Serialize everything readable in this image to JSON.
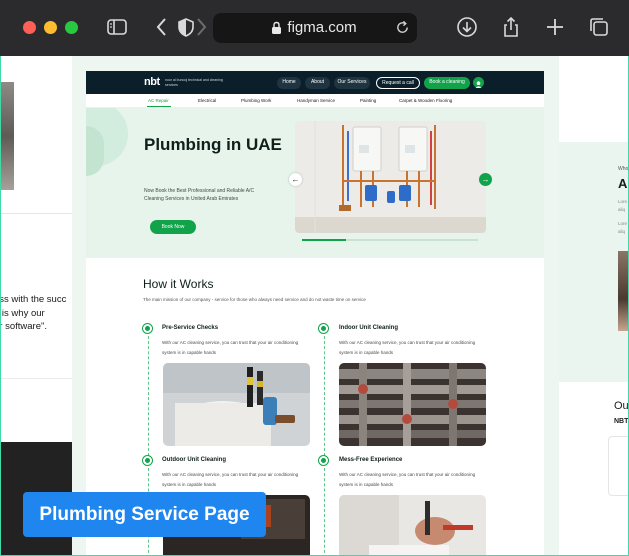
{
  "browser": {
    "url": "figma.com",
    "colors": {
      "chrome": "#2b2b2d",
      "urlbar": "#161617"
    }
  },
  "left_panel": {
    "quote_lines": [
      "ess with the succ",
      "h is why our",
      "ur software\"."
    ]
  },
  "right_panel": {
    "small_label": "Who",
    "big_text": "Al",
    "text_lines": [
      "Lore",
      "aliq",
      "Lore",
      "aliq"
    ],
    "heading": "Ou",
    "brand": "NBT"
  },
  "site": {
    "logo_mark": "nbt",
    "logo_text": "noor al bunooj technical and cleaning services",
    "nav": [
      {
        "label": "Home"
      },
      {
        "label": "About"
      },
      {
        "label": "Our Services"
      },
      {
        "label": "Request a call"
      },
      {
        "label": "Book a cleaning"
      }
    ],
    "subnav": [
      {
        "label": "AC Repair",
        "active": true
      },
      {
        "label": "Electrical"
      },
      {
        "label": "Plumbing Work"
      },
      {
        "label": "Handyman Service"
      },
      {
        "label": "Painting"
      },
      {
        "label": "Carpet & Wooden Flooring"
      }
    ],
    "hero": {
      "title": "Plumbing in UAE",
      "subtitle": "Now Book the Best Professional and Reliable A/C Cleaning Services in United Arab Emirates",
      "button": "Book Now",
      "slide_progress": 0.25,
      "prev_arrow": "←",
      "next_arrow": "→"
    },
    "how_it_works": {
      "title": "How it Works",
      "subtitle": "The main mission of our company - service for those who always need service and do not waste time on service",
      "steps": [
        {
          "title": "Pre-Service Checks",
          "desc": "With our AC cleaning service, you can trust that your air conditioning system is in capable hands"
        },
        {
          "title": "Indoor Unit Cleaning",
          "desc": "With our AC cleaning service, you can trust that your air conditioning system is in capable hands"
        },
        {
          "title": "Outdoor Unit Cleaning",
          "desc": "With our AC cleaning service, you can trust that your air conditioning system is in capable hands"
        },
        {
          "title": "Mess-Free Experience",
          "desc": "With our AC cleaning service, you can trust that your air conditioning system is in capable hands"
        }
      ]
    },
    "colors": {
      "brand_green": "#12a34a",
      "nav_dark": "#0b1f2a",
      "hero_bg": "#e6f4ec"
    }
  },
  "badge": {
    "label": "Plumbing Service Page",
    "color": "#1f86f0"
  }
}
